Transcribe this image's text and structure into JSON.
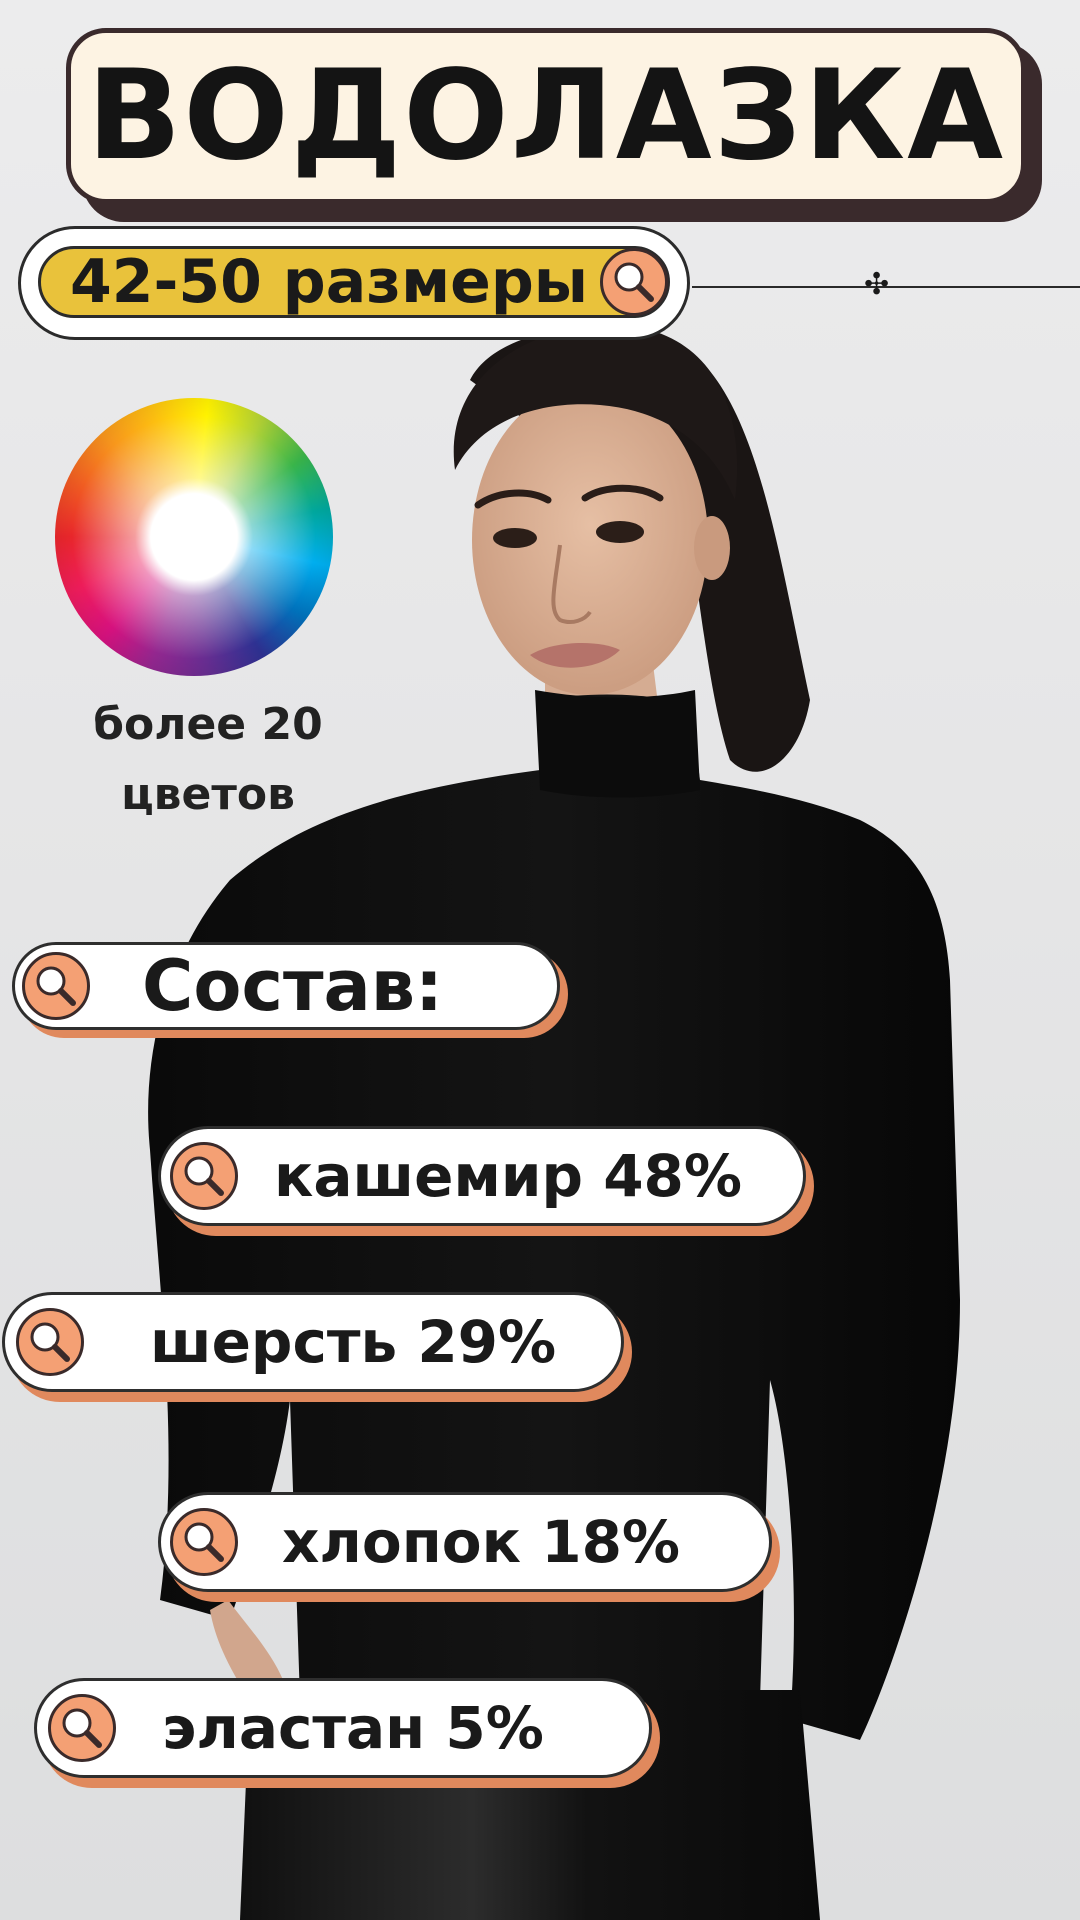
{
  "title": "ВОДОЛАЗКА",
  "sizes_label": "42-50 размеры",
  "colors_label_line1": "более 20",
  "colors_label_line2": "цветов",
  "composition": {
    "heading": "Состав:",
    "items": [
      {
        "label": "кашемир 48%"
      },
      {
        "label": "шерсть 29%"
      },
      {
        "label": "хлопок 18%"
      },
      {
        "label": "эластан 5%"
      }
    ]
  },
  "colors": {
    "title_bg": "#fdf3e3",
    "title_border": "#3a2a2c",
    "sizes_pill": "#e9c23b",
    "icon_fill": "#f4a074",
    "pill_shadow": "#e0895d"
  },
  "icons": [
    "magnifier-icon",
    "color-wheel",
    "ornament-star-icon"
  ]
}
